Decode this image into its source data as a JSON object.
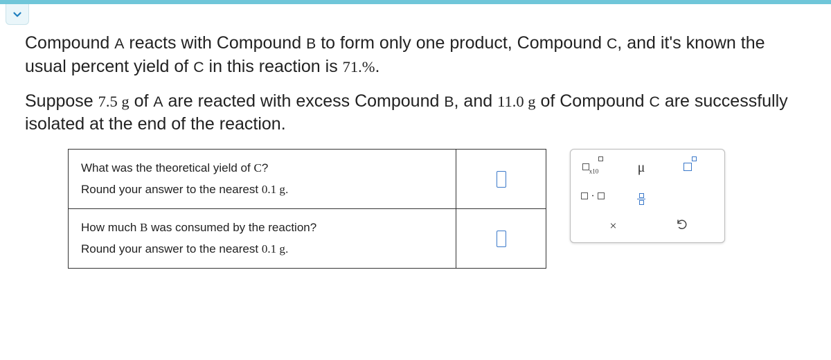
{
  "toggle": {
    "icon": "chevron-down"
  },
  "para1": {
    "pre1": "Compound ",
    "A": "A",
    "mid1": " reacts with Compound ",
    "B": "B",
    "mid2": " to form only one product, Compound ",
    "C": "C",
    "mid3": ", and it's known the usual percent yield of ",
    "C2": "C",
    "mid4": " in this reaction is ",
    "yield": "71.%",
    "end": "."
  },
  "para2": {
    "pre1": "Suppose ",
    "massA": "7.5 g",
    "of": " of ",
    "A": "A",
    "mid1": " are reacted with excess Compound ",
    "B": "B",
    "mid2": ", and ",
    "massC": "11.0 g",
    "mid3": " of Compound ",
    "C": "C",
    "mid4": " are successfully isolated at the end of the reaction."
  },
  "q1": {
    "line1a": "What was the theoretical yield of ",
    "C": "C",
    "line1b": "?",
    "line2a": "Round your answer to the nearest ",
    "round": "0.1 g",
    "line2b": "."
  },
  "q2": {
    "line1a": "How much ",
    "B": "B",
    "line1b": " was consumed by the reaction?",
    "line2a": "Round your answer to the nearest ",
    "round": "0.1 g",
    "line2b": "."
  },
  "tools": {
    "mu": "μ",
    "dot": "·",
    "x10": "x10",
    "times": "×"
  }
}
